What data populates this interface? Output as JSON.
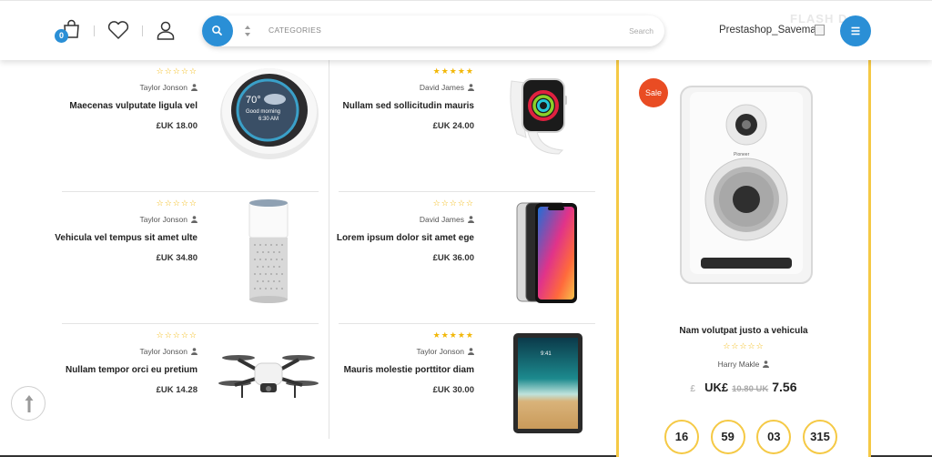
{
  "header": {
    "cart_count": "0",
    "search": {
      "categories_label": "CATEGORIES",
      "placeholder": "Search"
    },
    "logo_text": "Prestashop_Savemart",
    "flash_ghost_text": "FLASH D"
  },
  "products_left": [
    {
      "stars": "☆☆☆☆☆",
      "author": "Taylor Jonson",
      "name": "Maecenas vulputate ligula vel",
      "price": "£UK 18.00",
      "image": "smart-speaker-display"
    },
    {
      "stars": "☆☆☆☆☆",
      "author": "Taylor Jonson",
      "name": "Vehicula vel tempus sit amet ulte",
      "price": "£UK 34.80",
      "image": "cylinder-smart-speaker"
    },
    {
      "stars": "☆☆☆☆☆",
      "author": "Taylor Jonson",
      "name": "Nullam tempor orci eu pretium",
      "price": "£UK 14.28",
      "image": "drone"
    }
  ],
  "products_right": [
    {
      "stars": "★★★★★",
      "author": "David James",
      "name": "Nullam sed sollicitudin mauris",
      "price": "£UK 24.00",
      "image": "smart-watch"
    },
    {
      "stars": "☆☆☆☆☆",
      "author": "David James",
      "name": "Lorem ipsum dolor sit amet ege",
      "price": "£UK 36.00",
      "image": "smartphones"
    },
    {
      "stars": "★★★★★",
      "author": "Taylor Jonson",
      "name": "Mauris molestie porttitor diam",
      "price": "£UK 30.00",
      "image": "tablet"
    }
  ],
  "featured": {
    "badge": "Sale",
    "name": "Nam volutpat justo a vehicula",
    "stars": "☆☆☆☆☆",
    "author": "Harry Makle",
    "currency": "£",
    "unit": "UK£",
    "old_price": "10.80 UK",
    "new_price": "7.56",
    "countdown": [
      "16",
      "59",
      "03",
      "315"
    ],
    "image": "studio-monitor-speaker"
  },
  "colors": {
    "accent_blue": "#2a8fd6",
    "star_yellow": "#f2b707",
    "featured_border": "#f5c945",
    "sale_red": "#e94c23"
  }
}
